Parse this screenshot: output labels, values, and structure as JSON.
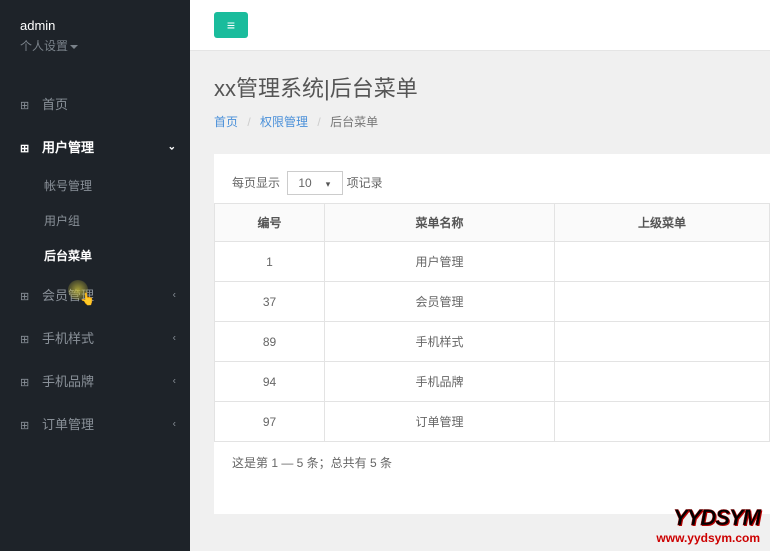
{
  "user": {
    "name": "admin",
    "settings_label": "个人设置"
  },
  "nav": {
    "home": "首页",
    "user_mgmt": "用户管理",
    "user_sub": {
      "account": "帐号管理",
      "group": "用户组",
      "menu": "后台菜单"
    },
    "member": "会员管理",
    "phone_style": "手机样式",
    "phone_brand": "手机品牌",
    "order": "订单管理"
  },
  "page": {
    "title": "xx管理系统|后台菜单",
    "bc_home": "首页",
    "bc_mid": "权限管理",
    "bc_current": "后台菜单"
  },
  "table": {
    "per_page_prefix": "每页显示",
    "per_page_value": "10",
    "per_page_suffix": "项记录",
    "cols": {
      "id": "编号",
      "name": "菜单名称",
      "parent": "上级菜单"
    },
    "rows": [
      {
        "id": "1",
        "name": "用户管理",
        "parent": ""
      },
      {
        "id": "37",
        "name": "会员管理",
        "parent": ""
      },
      {
        "id": "89",
        "name": "手机样式",
        "parent": ""
      },
      {
        "id": "94",
        "name": "手机品牌",
        "parent": ""
      },
      {
        "id": "97",
        "name": "订单管理",
        "parent": ""
      }
    ],
    "footer": "这是第 1 — 5 条；总共有 5 条"
  },
  "watermark": {
    "top": "YYDSYM",
    "bottom": "www.yydsym.com"
  }
}
